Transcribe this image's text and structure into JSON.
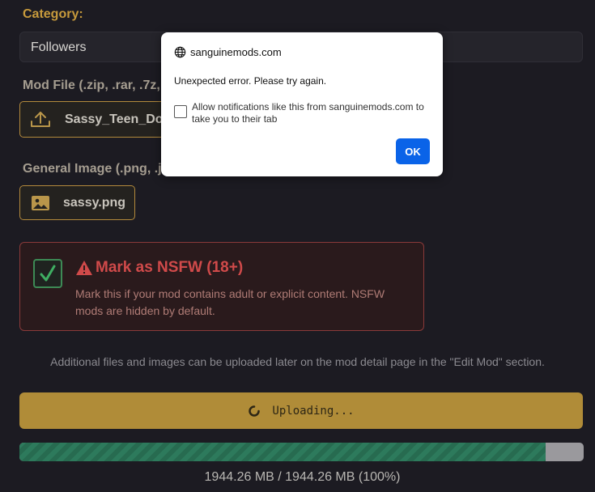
{
  "form": {
    "category_label": "Category:",
    "category_value": "Followers",
    "mod_file_label": "Mod File (.zip, .rar, .7z,",
    "mod_file_name": "Sassy_Teen_Do",
    "image_label": "General Image (.png, .j",
    "image_file_name": "sassy.png",
    "nsfw_title": "Mark as NSFW (18+)",
    "nsfw_desc": "Mark this if your mod contains adult or explicit content. NSFW mods are hidden by default.",
    "nsfw_checked": true,
    "note": "Additional files and images can be uploaded later on the mod detail page in the \"Edit Mod\" section.",
    "upload_button_label": "Uploading...",
    "progress_percent": 100,
    "progress_text": "1944.26 MB / 1944.26 MB (100%)"
  },
  "dialog": {
    "origin": "sanguinemods.com",
    "message": "Unexpected error. Please try again.",
    "checkbox_label": "Allow notifications like this from sanguinemods.com to take you to their tab",
    "ok_label": "OK"
  },
  "colors": {
    "accent": "#b08c38",
    "danger": "#d04a4a",
    "success": "#3d8a55",
    "dialog_button": "#0a63e8"
  },
  "icons": {
    "mod_file": "upload-icon",
    "image_file": "image-icon",
    "nsfw_check": "checkmark-icon",
    "nsfw_warning": "warning-icon",
    "upload_spinner": "spinner-icon",
    "dialog_origin": "globe-icon"
  }
}
